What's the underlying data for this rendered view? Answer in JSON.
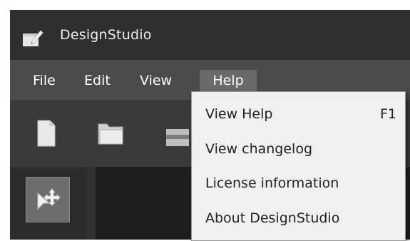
{
  "window": {
    "title": "DesignStudio",
    "app_icon": "design-app-icon"
  },
  "menubar": {
    "items": [
      {
        "label": "File"
      },
      {
        "label": "Edit"
      },
      {
        "label": "View"
      },
      {
        "label": "Help",
        "active": true
      }
    ]
  },
  "toolbar": {
    "tools": [
      "new-document-icon",
      "open-folder-icon",
      "save-icon"
    ]
  },
  "sidepanel": {
    "selected_tool": "select-move-icon"
  },
  "help_menu": {
    "items": [
      {
        "label": "View Help",
        "shortcut": "F1"
      },
      {
        "label": "View changelog",
        "shortcut": ""
      },
      {
        "label": "License information",
        "shortcut": ""
      },
      {
        "label": "About DesignStudio",
        "shortcut": ""
      }
    ]
  },
  "colors": {
    "titlebar": "#2f2f2f",
    "menubar": "#4b4b4b",
    "menu_active": "#6a6a6a",
    "dropdown_bg": "#f0f0f0",
    "canvas": "#1e1e1e"
  }
}
